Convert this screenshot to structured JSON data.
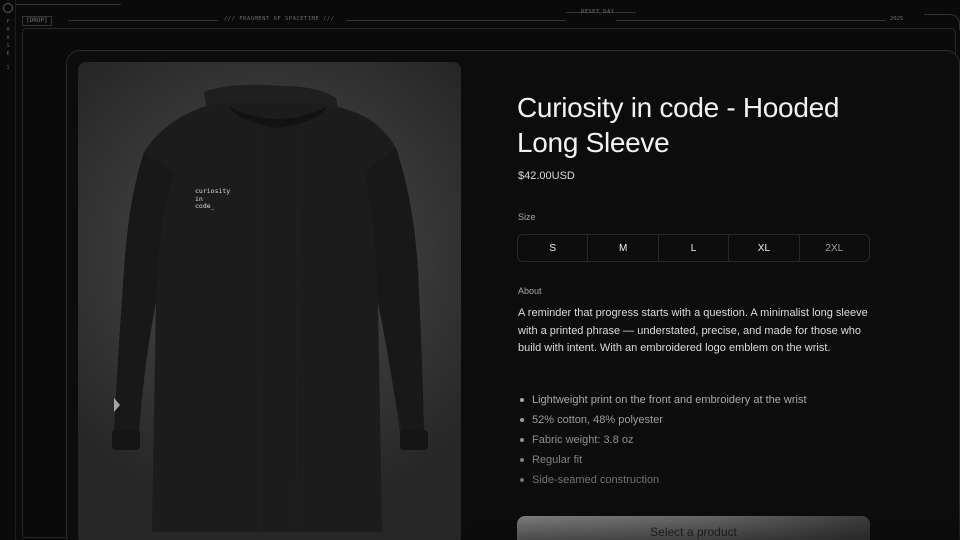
{
  "chrome": {
    "rail_letters": [
      "P",
      "H",
      "A",
      "S",
      "E"
    ],
    "rail_number": "1",
    "drop_tag": "[DROP]",
    "fragment_tag": "/// FRAGMENT OF SPACETIME ///",
    "reset_tag": "RESET_DAY",
    "year_tag": "2025"
  },
  "product": {
    "image_alt": "Black hooded long sleeve",
    "print_text": "curiosity\nin\ncode_",
    "title": "Curiosity in code - Hooded Long Sleeve",
    "price": "$42.00USD",
    "size_label": "Size",
    "sizes": [
      "S",
      "M",
      "L",
      "XL",
      "2XL"
    ],
    "about_label": "About",
    "about_text": "A reminder that progress starts with a question. A minimalist long sleeve with a printed phrase — understated, precise, and made for those who build with intent. With an embroidered logo emblem on the wrist.",
    "features": [
      "Lightweight print on the front and embroidery at the wrist",
      "52% cotton, 48% polyester",
      "Fabric weight: 3.8 oz",
      "Regular fit",
      "Side-seamed construction"
    ],
    "cta_label": "Select a product"
  }
}
